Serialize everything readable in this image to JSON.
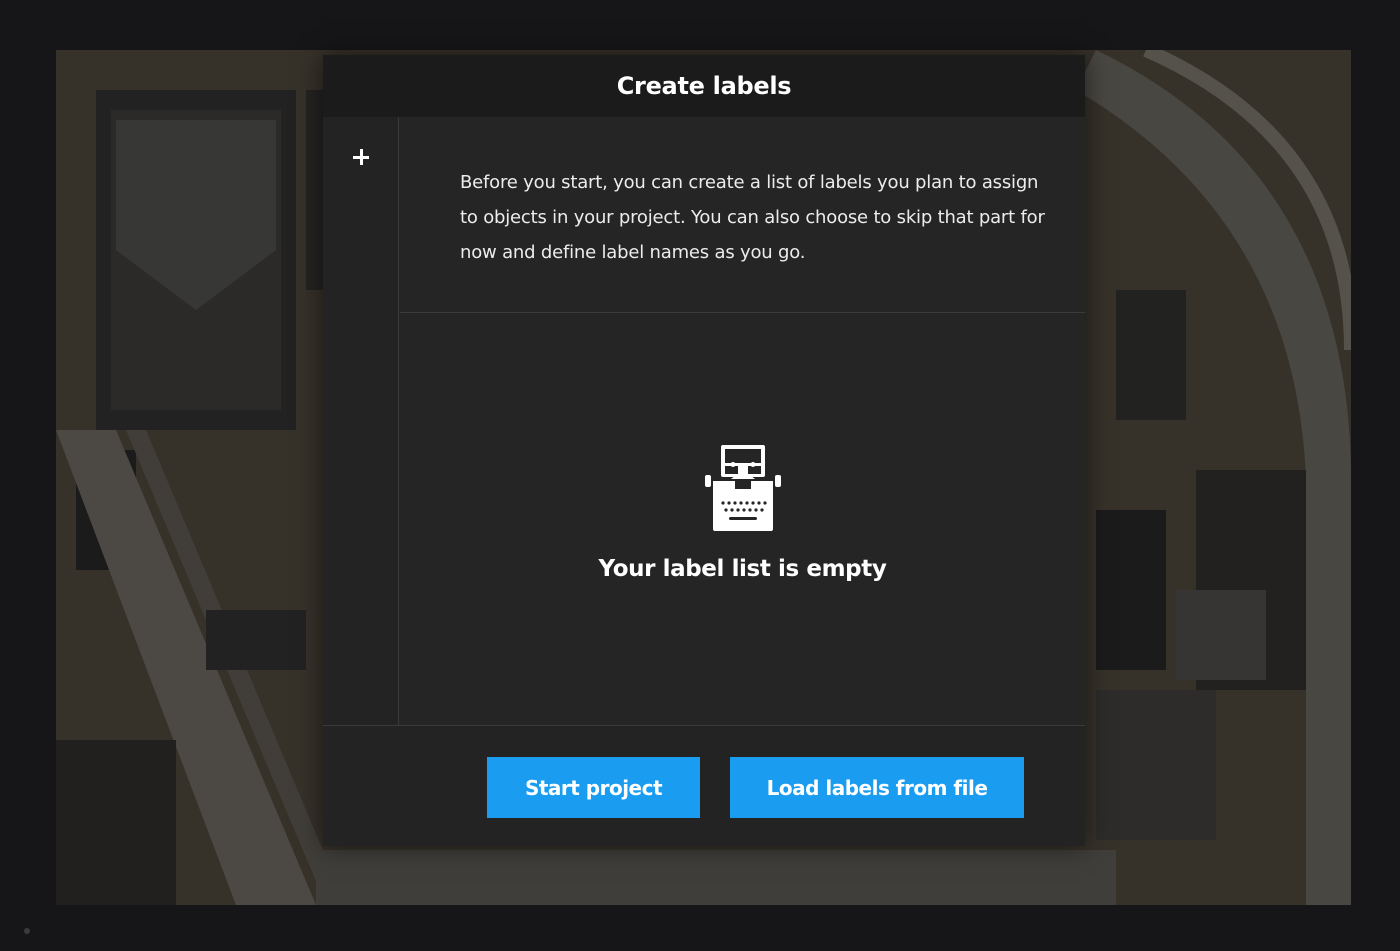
{
  "modal": {
    "title": "Create labels",
    "description": "Before you start, you can create a list of labels you plan to assign to objects in your project. You can also choose to skip that part for now and define label names as you go.",
    "add_icon": "plus-icon",
    "empty_state": {
      "icon": "typewriter-icon",
      "message": "Your label list is empty"
    },
    "buttons": {
      "start_project": "Start project",
      "load_labels": "Load labels from file"
    }
  },
  "colors": {
    "page_background": "#17181b",
    "modal_background": "#252525",
    "header_background": "#1b1b1b",
    "accent": "#1a9cf0",
    "text": "#ffffff"
  }
}
